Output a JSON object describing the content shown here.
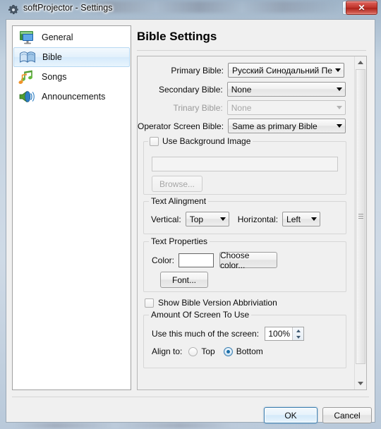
{
  "window": {
    "title": "softProjector - Settings",
    "icon": "gear-icon",
    "help_label": "?",
    "close_label": "✕"
  },
  "sidebar": {
    "items": [
      {
        "label": "General",
        "icon": "monitor-icon",
        "selected": false
      },
      {
        "label": "Bible",
        "icon": "book-icon",
        "selected": true
      },
      {
        "label": "Songs",
        "icon": "music-notes-icon",
        "selected": false
      },
      {
        "label": "Announcements",
        "icon": "speaker-icon",
        "selected": false
      }
    ]
  },
  "main": {
    "page_title": "Bible Settings",
    "bible_selection": {
      "primary_label": "Primary Bible:",
      "primary_value": "Русский Синодальний Перево,",
      "secondary_label": "Secondary Bible:",
      "secondary_value": "None",
      "trinary_label": "Trinary Bible:",
      "trinary_value": "None",
      "operator_label": "Operator Screen Bible:",
      "operator_value": "Same as primary Bible"
    },
    "background_image": {
      "group_title": "Use Background Image",
      "checked": false,
      "path_value": "",
      "browse_label": "Browse..."
    },
    "text_alignment": {
      "group_title": "Text Alingment",
      "vertical_label": "Vertical:",
      "vertical_value": "Top",
      "horizontal_label": "Horizontal:",
      "horizontal_value": "Left"
    },
    "text_properties": {
      "group_title": "Text Properties",
      "color_label": "Color:",
      "color_value": "#ffffff",
      "choose_color_label": "Choose color...",
      "font_label": "Font..."
    },
    "show_abbreviation": {
      "label": "Show Bible Version Abbriviation",
      "checked": false
    },
    "screen_amount": {
      "group_title": "Amount Of Screen To Use",
      "amount_label": "Use this much of the screen:",
      "amount_value": "100%",
      "align_label": "Align to:",
      "option_top": "Top",
      "option_bottom": "Bottom",
      "selected": "Bottom"
    }
  },
  "footer": {
    "ok_label": "OK",
    "cancel_label": "Cancel"
  },
  "colors": {
    "accent": "#3c7fb1",
    "close_red": "#c0352c",
    "window_bg": "#f0f0f0"
  }
}
